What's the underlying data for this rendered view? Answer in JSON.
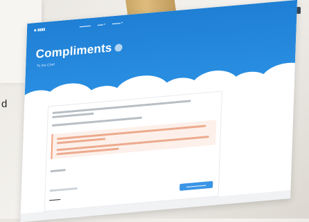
{
  "page": {
    "title": "Compliments",
    "subtitle": "To the Chef"
  },
  "photo_bits": {
    "edge_char": "d"
  },
  "colors": {
    "hero_blue": "#2a8fe2",
    "note_bg": "#fdf0ea",
    "cta_blue": "#3a95e6"
  },
  "icons": {
    "info": "info-icon"
  }
}
